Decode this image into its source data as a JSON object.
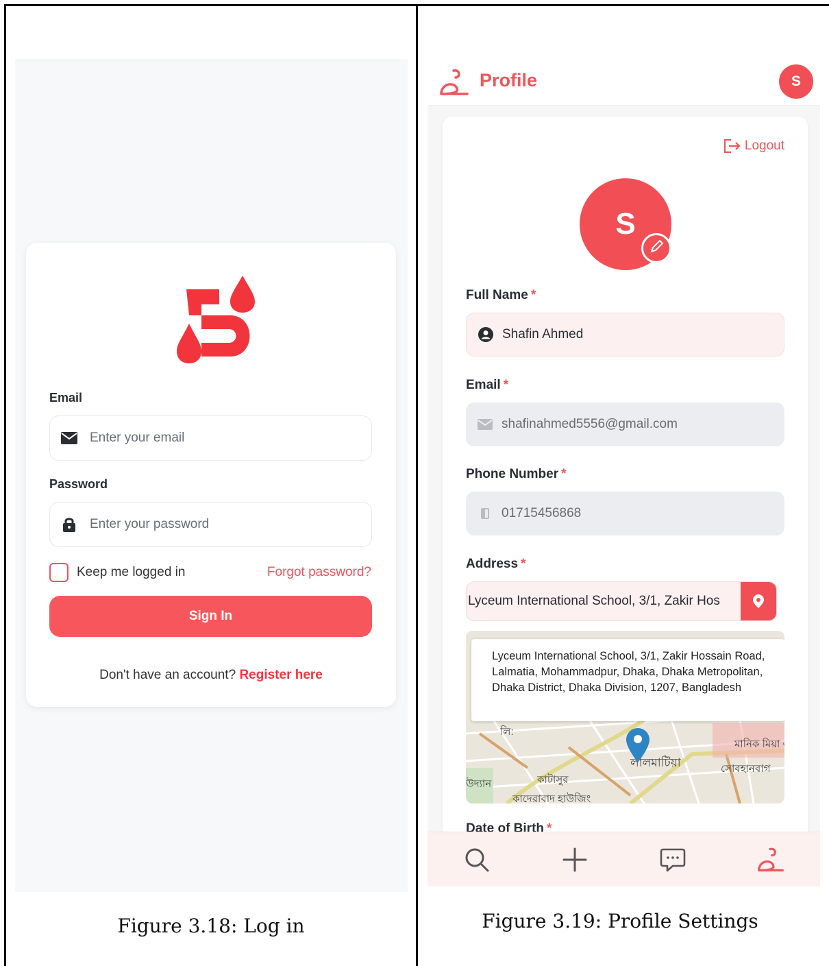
{
  "login": {
    "email_label": "Email",
    "email_placeholder": "Enter your email",
    "password_label": "Password",
    "password_placeholder": "Enter your password",
    "keep_logged_in": "Keep me logged in",
    "forgot_password": "Forgot password?",
    "sign_in": "Sign In",
    "no_account": "Don't have an account?",
    "register": "Register here",
    "brand_color": "#f2353d"
  },
  "profile": {
    "title": "Profile",
    "avatar_initial": "S",
    "logout": "Logout",
    "full_name_label": "Full Name",
    "full_name": "Shafin Ahmed",
    "email_label": "Email",
    "email": "shafinahmed5556@gmail.com",
    "phone_label": "Phone Number",
    "phone": "01715456868",
    "address_label": "Address",
    "address": "Lyceum International School, 3/1, Zakir Hos",
    "required_mark": "*",
    "map_popup": "Lyceum International School, 3/1, Zakir Hossain Road, Lalmatia, Mohammadpur, Dhaka, Dhaka Metropolitan, Dhaka District, Dhaka Division, 1207, Bangladesh",
    "map_labels": [
      "লালমাটিয়া",
      "কাটাসুর",
      "কাদেরাবাদ হাউজিং",
      "সোবহানবাগ",
      "মানিক মিয়া এ",
      "উদ্যান",
      "লি:"
    ],
    "dob_label": "Date of Birth",
    "nav": [
      "search-icon",
      "plus-icon",
      "chat-icon",
      "profile-icon"
    ]
  },
  "captions": {
    "login": "Figure 3.18: Log in",
    "profile": "Figure 3.19: Profile Settings"
  }
}
